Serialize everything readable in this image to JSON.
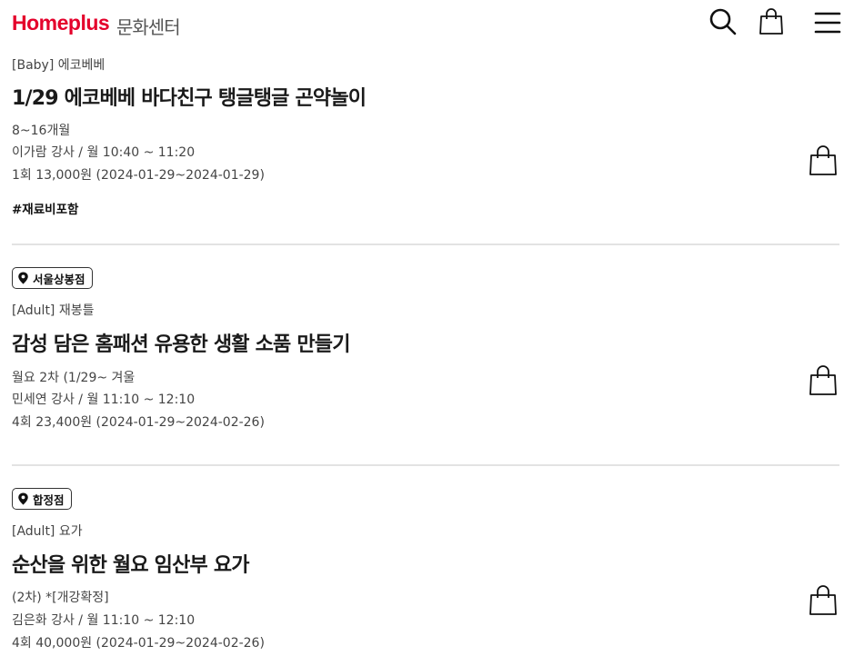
{
  "header": {
    "logo": "Homeplus",
    "logo_sub": "문화센터",
    "icons": [
      "search-icon",
      "shopping-bag-icon",
      "menu-icon"
    ]
  },
  "courses": [
    {
      "category": "[Baby] 에코베베",
      "title": "1/29 에코베베 바다친구 탱글탱글 곤약놀이",
      "line1": "8~16개월",
      "line2": "이가람 강사 / 월 10:40 ~ 11:20",
      "line3": "1회 13,000원 (2024-01-29~2024-01-29)",
      "tag": "#재료비포함"
    },
    {
      "branch": "서울상봉점",
      "category": "[Adult] 재봉틀",
      "title": "감성 담은 홈패션 유용한 생활 소품 만들기",
      "line1": "월요 2차 (1/29~ 겨울",
      "line2": "민세연 강사 / 월 11:10 ~ 12:10",
      "line3": "4회 23,400원 (2024-01-29~2024-02-26)"
    },
    {
      "branch": "합정점",
      "category": "[Adult] 요가",
      "title": "순산을 위한 월요 임산부 요가",
      "line1": "(2차) *[개강확정]",
      "line2": "김은화 강사 / 월 11:10 ~ 12:10",
      "line3": "4회 40,000원 (2024-01-29~2024-02-26)"
    }
  ],
  "colors": {
    "brand": "#e4002b",
    "text": "#222222",
    "divider": "#e3e3e3"
  }
}
